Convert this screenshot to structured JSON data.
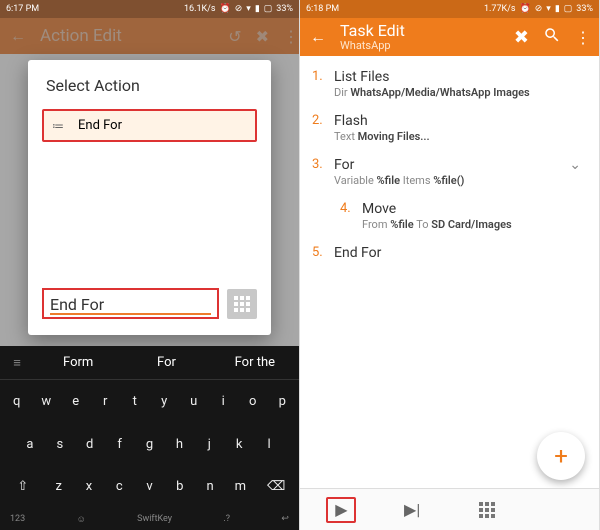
{
  "left": {
    "statusbar": {
      "time": "6:17 PM",
      "speed": "16.1K/s",
      "battery": "33%"
    },
    "topbar_title": "Action Edit",
    "dialog_title": "Select  Action",
    "action_label": "End For",
    "input_value": "End For",
    "suggestions": [
      "Form",
      "For",
      "For the"
    ],
    "keyboard_brand": "SwiftKey",
    "keyboard_numkey": "123",
    "rows": {
      "r1": [
        "q",
        "w",
        "e",
        "r",
        "t",
        "y",
        "u",
        "i",
        "o",
        "p"
      ],
      "r2": [
        "a",
        "s",
        "d",
        "f",
        "g",
        "h",
        "j",
        "k",
        "l"
      ],
      "r3": [
        "⇧",
        "z",
        "x",
        "c",
        "v",
        "b",
        "n",
        "m",
        "⌫"
      ]
    }
  },
  "right": {
    "statusbar": {
      "time": "6:18 PM",
      "speed": "1.77K/s",
      "battery": "33%"
    },
    "title": "Task Edit",
    "subtitle": "WhatsApp",
    "steps": [
      {
        "n": "1.",
        "title": "List Files",
        "sub_pre": "Dir ",
        "sub_b": "WhatsApp/Media/WhatsApp Images",
        "sub_post": ""
      },
      {
        "n": "2.",
        "title": "Flash",
        "sub_pre": "Text ",
        "sub_b": "Moving Files...",
        "sub_post": ""
      },
      {
        "n": "3.",
        "title": "For",
        "sub_pre": "Variable ",
        "sub_b": "%file",
        "sub_post": " Items ",
        "sub_b2": "%file()"
      },
      {
        "n": "4.",
        "title": "Move",
        "sub_pre": "From ",
        "sub_b": "%file",
        "sub_post": " To ",
        "sub_b2": "SD Card/Images"
      },
      {
        "n": "5.",
        "title": "End For",
        "sub_pre": "",
        "sub_b": "",
        "sub_post": ""
      }
    ]
  }
}
